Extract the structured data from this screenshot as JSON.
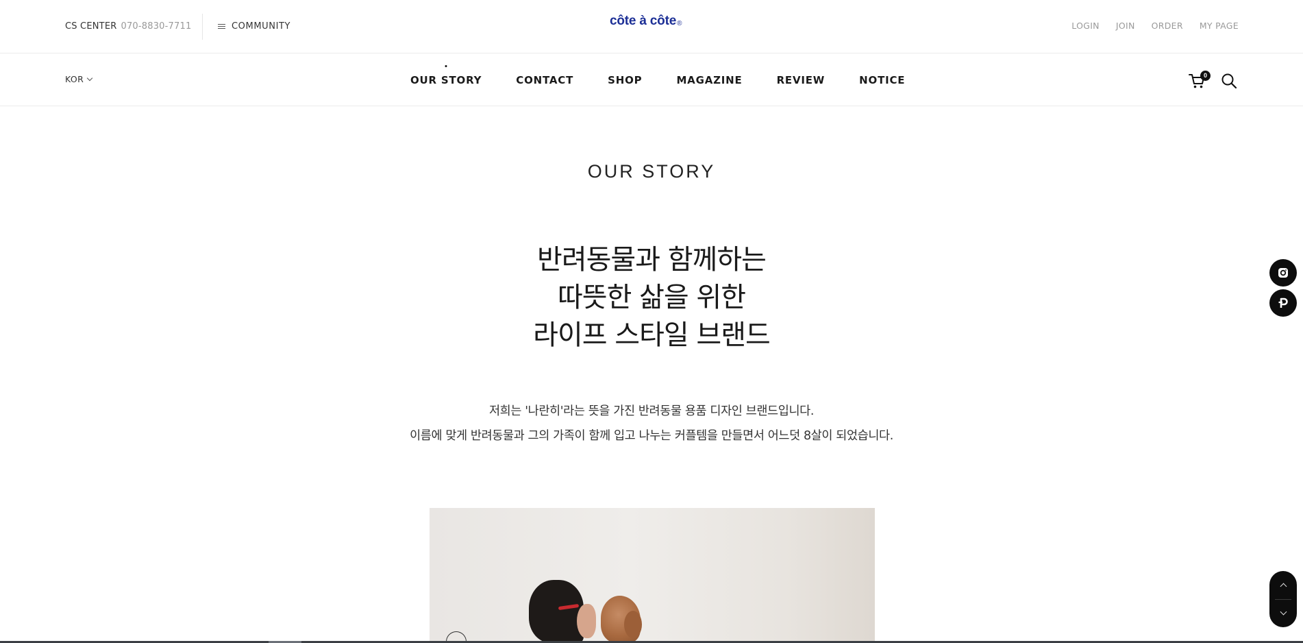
{
  "topbar": {
    "cs_label": "CS CENTER",
    "cs_phone": "070-8830-7711",
    "community_label": "COMMUNITY",
    "logo_text": "côte à côte",
    "logo_mark": "®",
    "links": {
      "login": "LOGIN",
      "join": "JOIN",
      "order": "ORDER",
      "mypage": "MY PAGE"
    }
  },
  "nav": {
    "language": "KOR",
    "items": [
      {
        "label": "OUR STORY",
        "active": true
      },
      {
        "label": "CONTACT"
      },
      {
        "label": "SHOP"
      },
      {
        "label": "MAGAZINE"
      },
      {
        "label": "REVIEW"
      },
      {
        "label": "NOTICE"
      }
    ],
    "cart_count": "0",
    "icons": [
      "cart-icon",
      "search-icon",
      "chevron-down-icon",
      "menu-icon"
    ]
  },
  "content": {
    "title": "OUR STORY",
    "headline": [
      "반려동물과 함께하는",
      "따뜻한 삶을 위한",
      "라이프 스타일 브랜드"
    ],
    "description": [
      "저희는 '나란히'라는 뜻을 가진 반려동물 용품 디자인 브랜드입니다.",
      "이름에 맞게 반려동물과 그의 가족이 함께 입고 나누는 커플템을 만들면서 어느덧 8살이 되었습니다."
    ]
  },
  "floating": {
    "icons": [
      "instagram-icon",
      "p-icon",
      "arrow-up-icon",
      "arrow-down-icon"
    ]
  },
  "colors": {
    "logo": "#1c2f96",
    "text": "#222222",
    "muted": "#999999",
    "float_bg": "#0d0d0d"
  }
}
